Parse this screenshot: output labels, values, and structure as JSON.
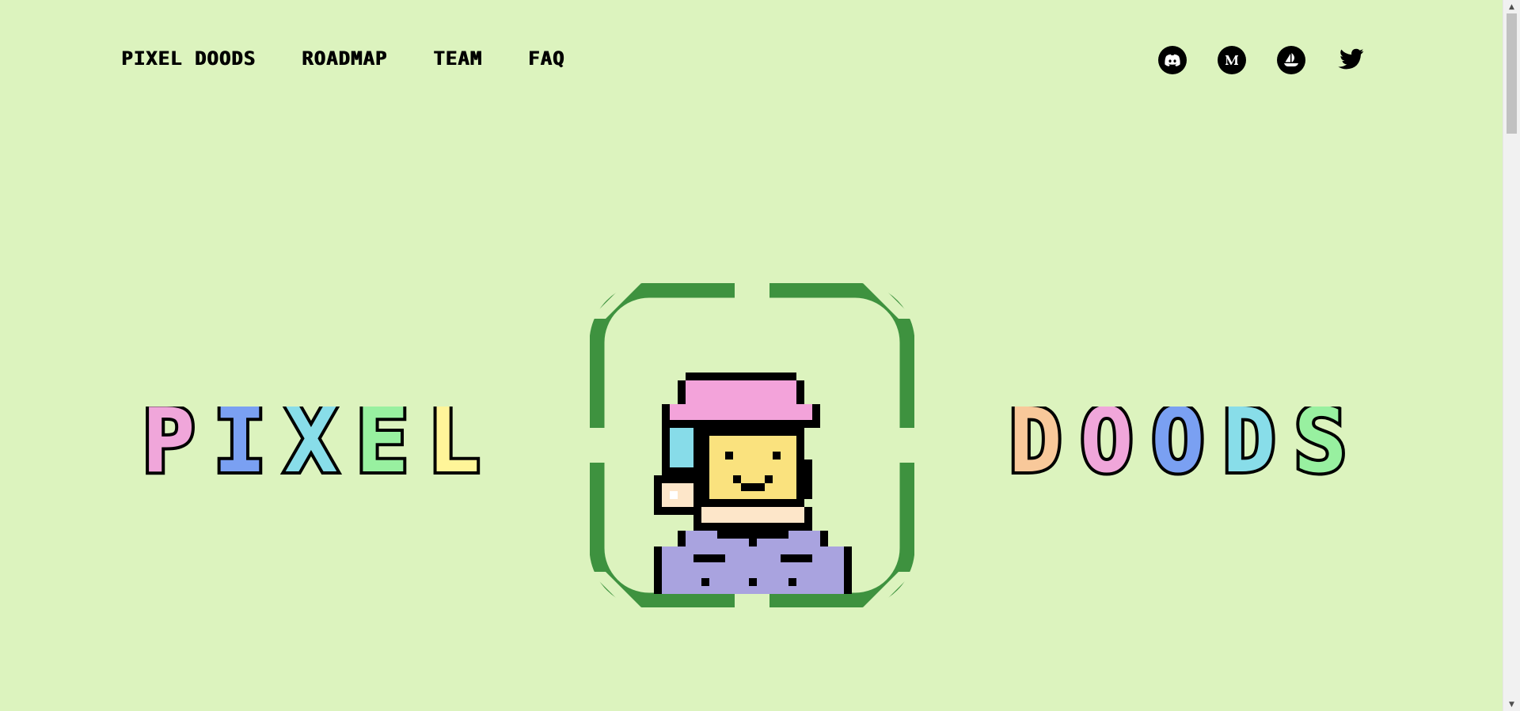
{
  "nav": {
    "items": [
      {
        "label": "PIXEL DOODS"
      },
      {
        "label": "ROADMAP"
      },
      {
        "label": "TEAM"
      },
      {
        "label": "FAQ"
      }
    ]
  },
  "socials": [
    {
      "name": "discord-icon"
    },
    {
      "name": "medium-icon"
    },
    {
      "name": "opensea-icon"
    },
    {
      "name": "twitter-icon"
    }
  ],
  "hero": {
    "left_word": "PIXEL",
    "right_word": "DOODS",
    "left_colors": [
      "#f0a6da",
      "#7aa0f2",
      "#88dde9",
      "#98f0a0",
      "#fff599"
    ],
    "right_colors": [
      "#f8c89a",
      "#f0a6da",
      "#7aa0f2",
      "#88dde9",
      "#98f0a0"
    ],
    "frame_color": "#3e923f"
  },
  "colors": {
    "background": "#dcf3be",
    "hat": "#f3a3da",
    "face": "#fae27e",
    "hair": "#87dce9",
    "skin": "#fde6c9",
    "shirt": "#a9a3df"
  }
}
